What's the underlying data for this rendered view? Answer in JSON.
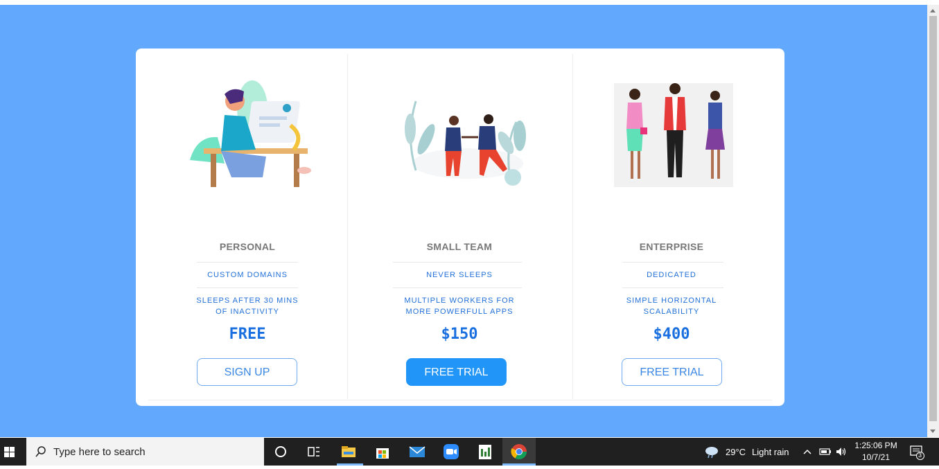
{
  "plans": [
    {
      "name": "PERSONAL",
      "features": [
        "CUSTOM DOMAINS",
        "SLEEPS AFTER 30 MINS OF INACTIVITY"
      ],
      "feature2_lines": [
        "SLEEPS AFTER 30 MINS",
        "OF INACTIVITY"
      ],
      "price": "FREE",
      "button": "SIGN UP"
    },
    {
      "name": "SMALL TEAM",
      "features": [
        "NEVER SLEEPS",
        "MULTIPLE WORKERS FOR MORE POWERFULL APPS"
      ],
      "feature2_lines": [
        "MULTIPLE WORKERS FOR",
        "MORE POWERFULL APPS"
      ],
      "price": "$150",
      "button": "FREE TRIAL"
    },
    {
      "name": "ENTERPRISE",
      "features": [
        "DEDICATED",
        "SIMPLE HORIZONTAL SCALABILITY"
      ],
      "feature2_lines": [
        "SIMPLE HORIZONTAL",
        "SCALABILITY"
      ],
      "price": "$400",
      "button": "FREE TRIAL"
    }
  ],
  "taskbar": {
    "search_placeholder": "Type here to search",
    "weather_temp": "29°C",
    "weather_desc": "Light rain",
    "time": "1:25:06 PM",
    "date": "10/7/21",
    "notification_count": "3",
    "apps": [
      "cortana-icon",
      "task-view-icon",
      "file-explorer-icon",
      "store-icon",
      "mail-icon",
      "zoom-icon",
      "notepad-icon",
      "chrome-icon"
    ]
  },
  "colors": {
    "page_background": "#62a8fd",
    "accent": "#1a6fe0",
    "primary_button": "#2196f8"
  }
}
